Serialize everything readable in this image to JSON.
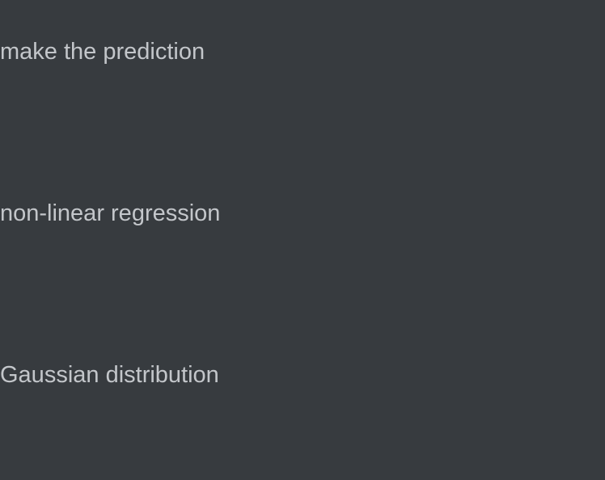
{
  "items": [
    {
      "label": "make the prediction"
    },
    {
      "label": "non-linear regression"
    },
    {
      "label": "Gaussian distribution"
    }
  ],
  "colors": {
    "background": "#373b3f",
    "text": "#c3c6ca"
  }
}
